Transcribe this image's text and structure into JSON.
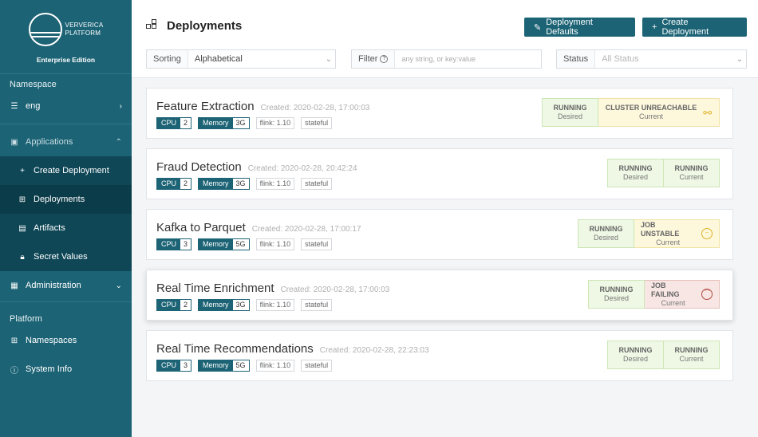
{
  "brand": {
    "name_line1": "VERVERICA",
    "name_line2": "PLATFORM",
    "edition": "Enterprise Edition"
  },
  "sidebar": {
    "namespace_label": "Namespace",
    "namespace_value": "eng",
    "applications_label": "Applications",
    "app_items": [
      {
        "label": "Create Deployment",
        "icon": "plus-icon"
      },
      {
        "label": "Deployments",
        "icon": "deployments-icon"
      },
      {
        "label": "Artifacts",
        "icon": "file-icon"
      },
      {
        "label": "Secret Values",
        "icon": "lock-icon"
      }
    ],
    "administration_label": "Administration",
    "platform_label": "Platform",
    "platform_items": [
      {
        "label": "Namespaces",
        "icon": "grid-icon"
      },
      {
        "label": "System Info",
        "icon": "info-icon"
      }
    ]
  },
  "header": {
    "title": "Deployments",
    "defaults_button": "Deployment Defaults",
    "create_button": "Create Deployment",
    "sorting_label": "Sorting",
    "sorting_value": "Alphabetical",
    "filter_label": "Filter",
    "filter_placeholder": "any string, or key:value",
    "status_label": "Status",
    "status_placeholder": "All Status"
  },
  "deployments": [
    {
      "name": "Feature Extraction",
      "created": "Created: 2020-02-28, 17:00:03",
      "cpu_label": "CPU",
      "cpu": "2",
      "memory_label": "Memory",
      "memory": "3G",
      "flink": "flink: 1.10",
      "mode": "stateful",
      "desired": "RUNNING",
      "desired_label": "Desired",
      "current": "CLUSTER UNREACHABLE",
      "current_label": "Current",
      "current_icon": "broken-link-icon"
    },
    {
      "name": "Fraud Detection",
      "created": "Created: 2020-02-28, 20:42:24",
      "cpu_label": "CPU",
      "cpu": "2",
      "memory_label": "Memory",
      "memory": "3G",
      "flink": "flink: 1.10",
      "mode": "stateful",
      "desired": "RUNNING",
      "desired_label": "Desired",
      "current": "RUNNING",
      "current_label": "Current"
    },
    {
      "name": "Kafka to Parquet",
      "created": "Created: 2020-02-28, 17:00:17",
      "cpu_label": "CPU",
      "cpu": "3",
      "memory_label": "Memory",
      "memory": "5G",
      "flink": "flink: 1.10",
      "mode": "stateful",
      "desired": "RUNNING",
      "desired_label": "Desired",
      "current": "JOB UNSTABLE",
      "current_label": "Current",
      "current_icon": "neutral-face-icon"
    },
    {
      "name": "Real Time Enrichment",
      "created": "Created: 2020-02-28, 17:00:03",
      "cpu_label": "CPU",
      "cpu": "2",
      "memory_label": "Memory",
      "memory": "3G",
      "flink": "flink: 1.10",
      "mode": "stateful",
      "desired": "RUNNING",
      "desired_label": "Desired",
      "current": "JOB FAILING",
      "current_label": "Current",
      "current_icon": "sad-face-icon"
    },
    {
      "name": "Real Time Recommendations",
      "created": "Created: 2020-02-28, 22:23:03",
      "cpu_label": "CPU",
      "cpu": "3",
      "memory_label": "Memory",
      "memory": "5G",
      "flink": "flink: 1.10",
      "mode": "stateful",
      "desired": "RUNNING",
      "desired_label": "Desired",
      "current": "RUNNING",
      "current_label": "Current"
    }
  ],
  "colors": {
    "brand_teal": "#1c6375",
    "running_green": "#eef8e4",
    "warning_yellow": "#fdf7dc",
    "failing_red": "#f7e6e4"
  }
}
